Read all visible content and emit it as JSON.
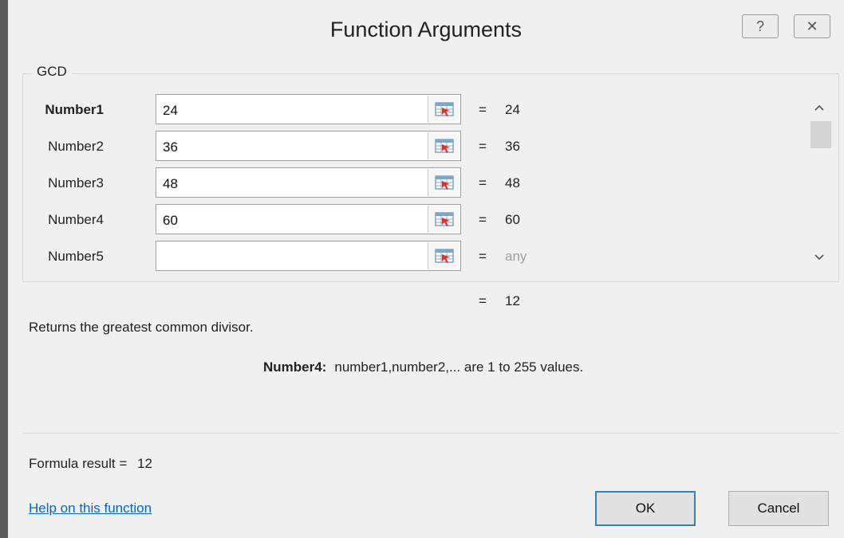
{
  "window": {
    "title": "Function Arguments",
    "help_glyph": "?",
    "close_glyph": "✕"
  },
  "function": {
    "name": "GCD",
    "arguments": [
      {
        "label": "Number1",
        "value": "24",
        "result": "24",
        "bold": true
      },
      {
        "label": "Number2",
        "value": "36",
        "result": "36",
        "bold": false
      },
      {
        "label": "Number3",
        "value": "48",
        "result": "48",
        "bold": false
      },
      {
        "label": "Number4",
        "value": "60",
        "result": "60",
        "bold": false
      },
      {
        "label": "Number5",
        "value": "",
        "result": "any",
        "bold": false
      }
    ],
    "equals": "=",
    "overall_result": "12",
    "description": "Returns the greatest common divisor.",
    "arg_help_name": "Number4:",
    "arg_help_text": "number1,number2,... are 1 to 255 values."
  },
  "footer": {
    "formula_result_label": "Formula result =",
    "formula_result_value": "12",
    "help_link": "Help on this function",
    "ok_label": "OK",
    "cancel_label": "Cancel"
  },
  "icons": {
    "ref_icon": "collapse-dialog-icon",
    "scroll_up": "chevron-up-icon",
    "scroll_down": "chevron-down-icon"
  }
}
